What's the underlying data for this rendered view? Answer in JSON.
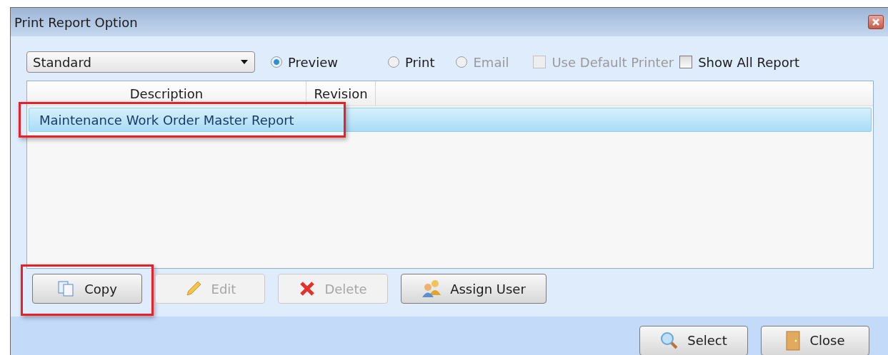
{
  "window": {
    "title": "Print Report Option"
  },
  "report_type": {
    "value": "Standard"
  },
  "output_options": [
    {
      "label": "Preview",
      "selected": true,
      "disabled": false
    },
    {
      "label": "Print",
      "selected": false,
      "disabled": false
    },
    {
      "label": "Email",
      "selected": false,
      "disabled": true
    }
  ],
  "checkboxes": [
    {
      "label": "Use Default Printer",
      "checked": false,
      "disabled": true
    },
    {
      "label": "Show All Report",
      "checked": false,
      "disabled": false
    }
  ],
  "table": {
    "columns": [
      "Description",
      "Revision"
    ],
    "rows": [
      {
        "cells": [
          "Maintenance Work Order Master Report",
          ""
        ],
        "selected": true,
        "highlighted": true
      }
    ]
  },
  "actions": [
    {
      "label": "Copy",
      "kind": "copy",
      "disabled": false,
      "highlighted": true
    },
    {
      "label": "Edit",
      "kind": "edit",
      "disabled": true,
      "highlighted": false
    },
    {
      "label": "Delete",
      "kind": "delete",
      "disabled": true,
      "highlighted": false
    },
    {
      "label": "Assign User",
      "kind": "users",
      "disabled": false,
      "highlighted": false
    }
  ],
  "footer_buttons": [
    {
      "label": "Select",
      "kind": "search"
    },
    {
      "label": "Close",
      "kind": "door"
    }
  ]
}
